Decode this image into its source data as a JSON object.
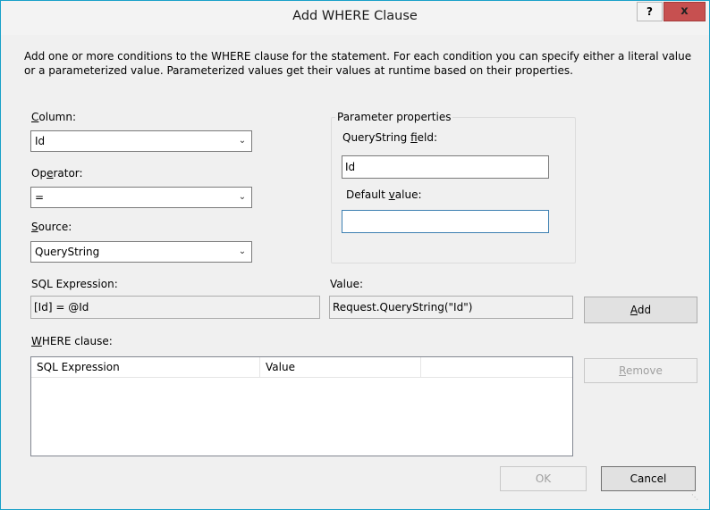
{
  "window": {
    "title": "Add WHERE Clause",
    "help_label": "?",
    "close_label": "x"
  },
  "description": "Add one or more conditions to the WHERE clause for the statement. For each condition you can specify either a literal value or a parameterized value. Parameterized values get their values at runtime based on their properties.",
  "column": {
    "label_u": "C",
    "label_rest": "olumn:",
    "value": "Id"
  },
  "operator": {
    "label_a": "Op",
    "label_u": "e",
    "label_rest": "rator:",
    "value": "="
  },
  "source": {
    "label_u": "S",
    "label_rest": "ource:",
    "value": "QueryString"
  },
  "parameter_properties": {
    "title": "Parameter properties",
    "field_label_a": "QueryString ",
    "field_label_u": "f",
    "field_label_rest": "ield:",
    "field_value": "Id",
    "default_label_a": "Default ",
    "default_label_u": "v",
    "default_label_rest": "alue:",
    "default_value": ""
  },
  "sql_expression": {
    "label": "SQL Expression:",
    "value": "[Id] = @Id"
  },
  "value": {
    "label": "Value:",
    "value": "Request.QueryString(\"Id\")"
  },
  "add_button": {
    "label_u": "A",
    "label_rest": "dd"
  },
  "where_clause": {
    "label_u": "W",
    "label_rest": "HERE clause:",
    "columns": [
      "SQL Expression",
      "Value"
    ],
    "rows": []
  },
  "remove_button": {
    "label_u": "R",
    "label_rest": "emove"
  },
  "ok_button": {
    "label": "OK"
  },
  "cancel_button": {
    "label": "Cancel"
  },
  "icons": {
    "dropdown": "chevron-down-icon",
    "grip": "resize-grip-icon"
  }
}
